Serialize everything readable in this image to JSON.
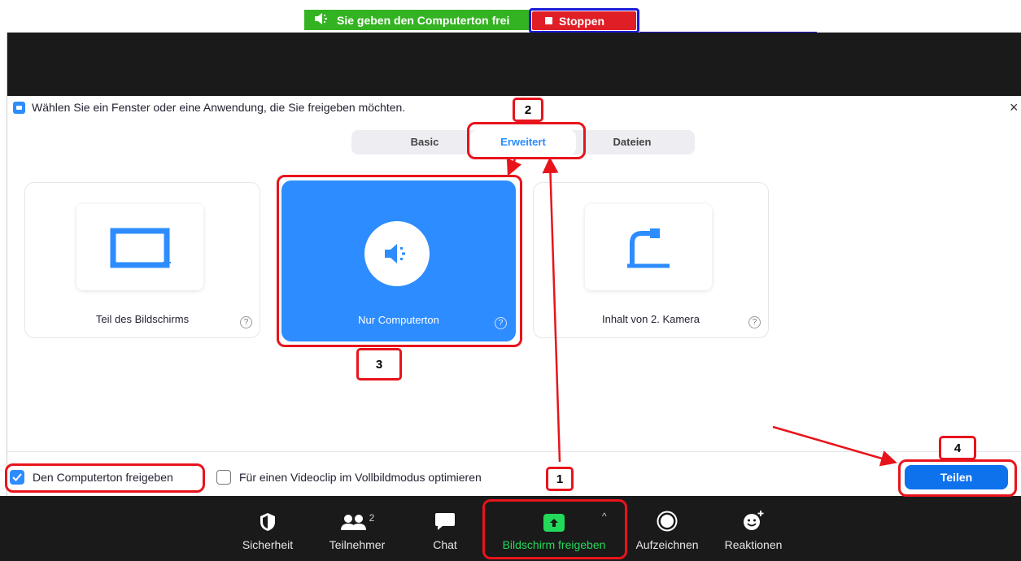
{
  "share_bar": {
    "status_text": "Sie geben den Computerton frei",
    "stop_label": "Stoppen"
  },
  "dialog": {
    "title": "Wählen Sie ein Fenster oder eine Anwendung, die Sie freigeben möchten.",
    "close_glyph": "×",
    "tabs": [
      {
        "label": "Basic",
        "selected": false
      },
      {
        "label": "Erweitert",
        "selected": true
      },
      {
        "label": "Dateien",
        "selected": false
      }
    ],
    "options": [
      {
        "label": "Teil des Bildschirms",
        "icon": "screen-portion-icon",
        "selected": false
      },
      {
        "label": "Nur Computerton",
        "icon": "speaker-icon",
        "selected": true
      },
      {
        "label": "Inhalt von 2. Kamera",
        "icon": "document-camera-icon",
        "selected": false
      }
    ],
    "help_glyph": "?",
    "checkboxes": [
      {
        "label": "Den Computerton freigeben",
        "checked": true
      },
      {
        "label": "Für einen Videoclip im Vollbildmodus optimieren",
        "checked": false
      }
    ],
    "share_button": "Teilen"
  },
  "annotations": {
    "step1": "1",
    "step2": "2",
    "step3": "3",
    "step4": "4",
    "color": "#e8141c"
  },
  "toolbar": {
    "items": [
      {
        "label": "Sicherheit",
        "icon": "shield-icon"
      },
      {
        "label": "Teilnehmer",
        "icon": "participants-icon",
        "count": "2"
      },
      {
        "label": "Chat",
        "icon": "chat-icon"
      },
      {
        "label": "Bildschirm freigeben",
        "icon": "share-screen-icon"
      },
      {
        "label": "Aufzeichnen",
        "icon": "record-icon"
      },
      {
        "label": "Reaktionen",
        "icon": "reactions-icon"
      }
    ],
    "caret": "^"
  },
  "colors": {
    "accent": "#2d8cff",
    "share_green": "#23d959",
    "status_green": "#34b322",
    "stop_red": "#e01e26"
  }
}
